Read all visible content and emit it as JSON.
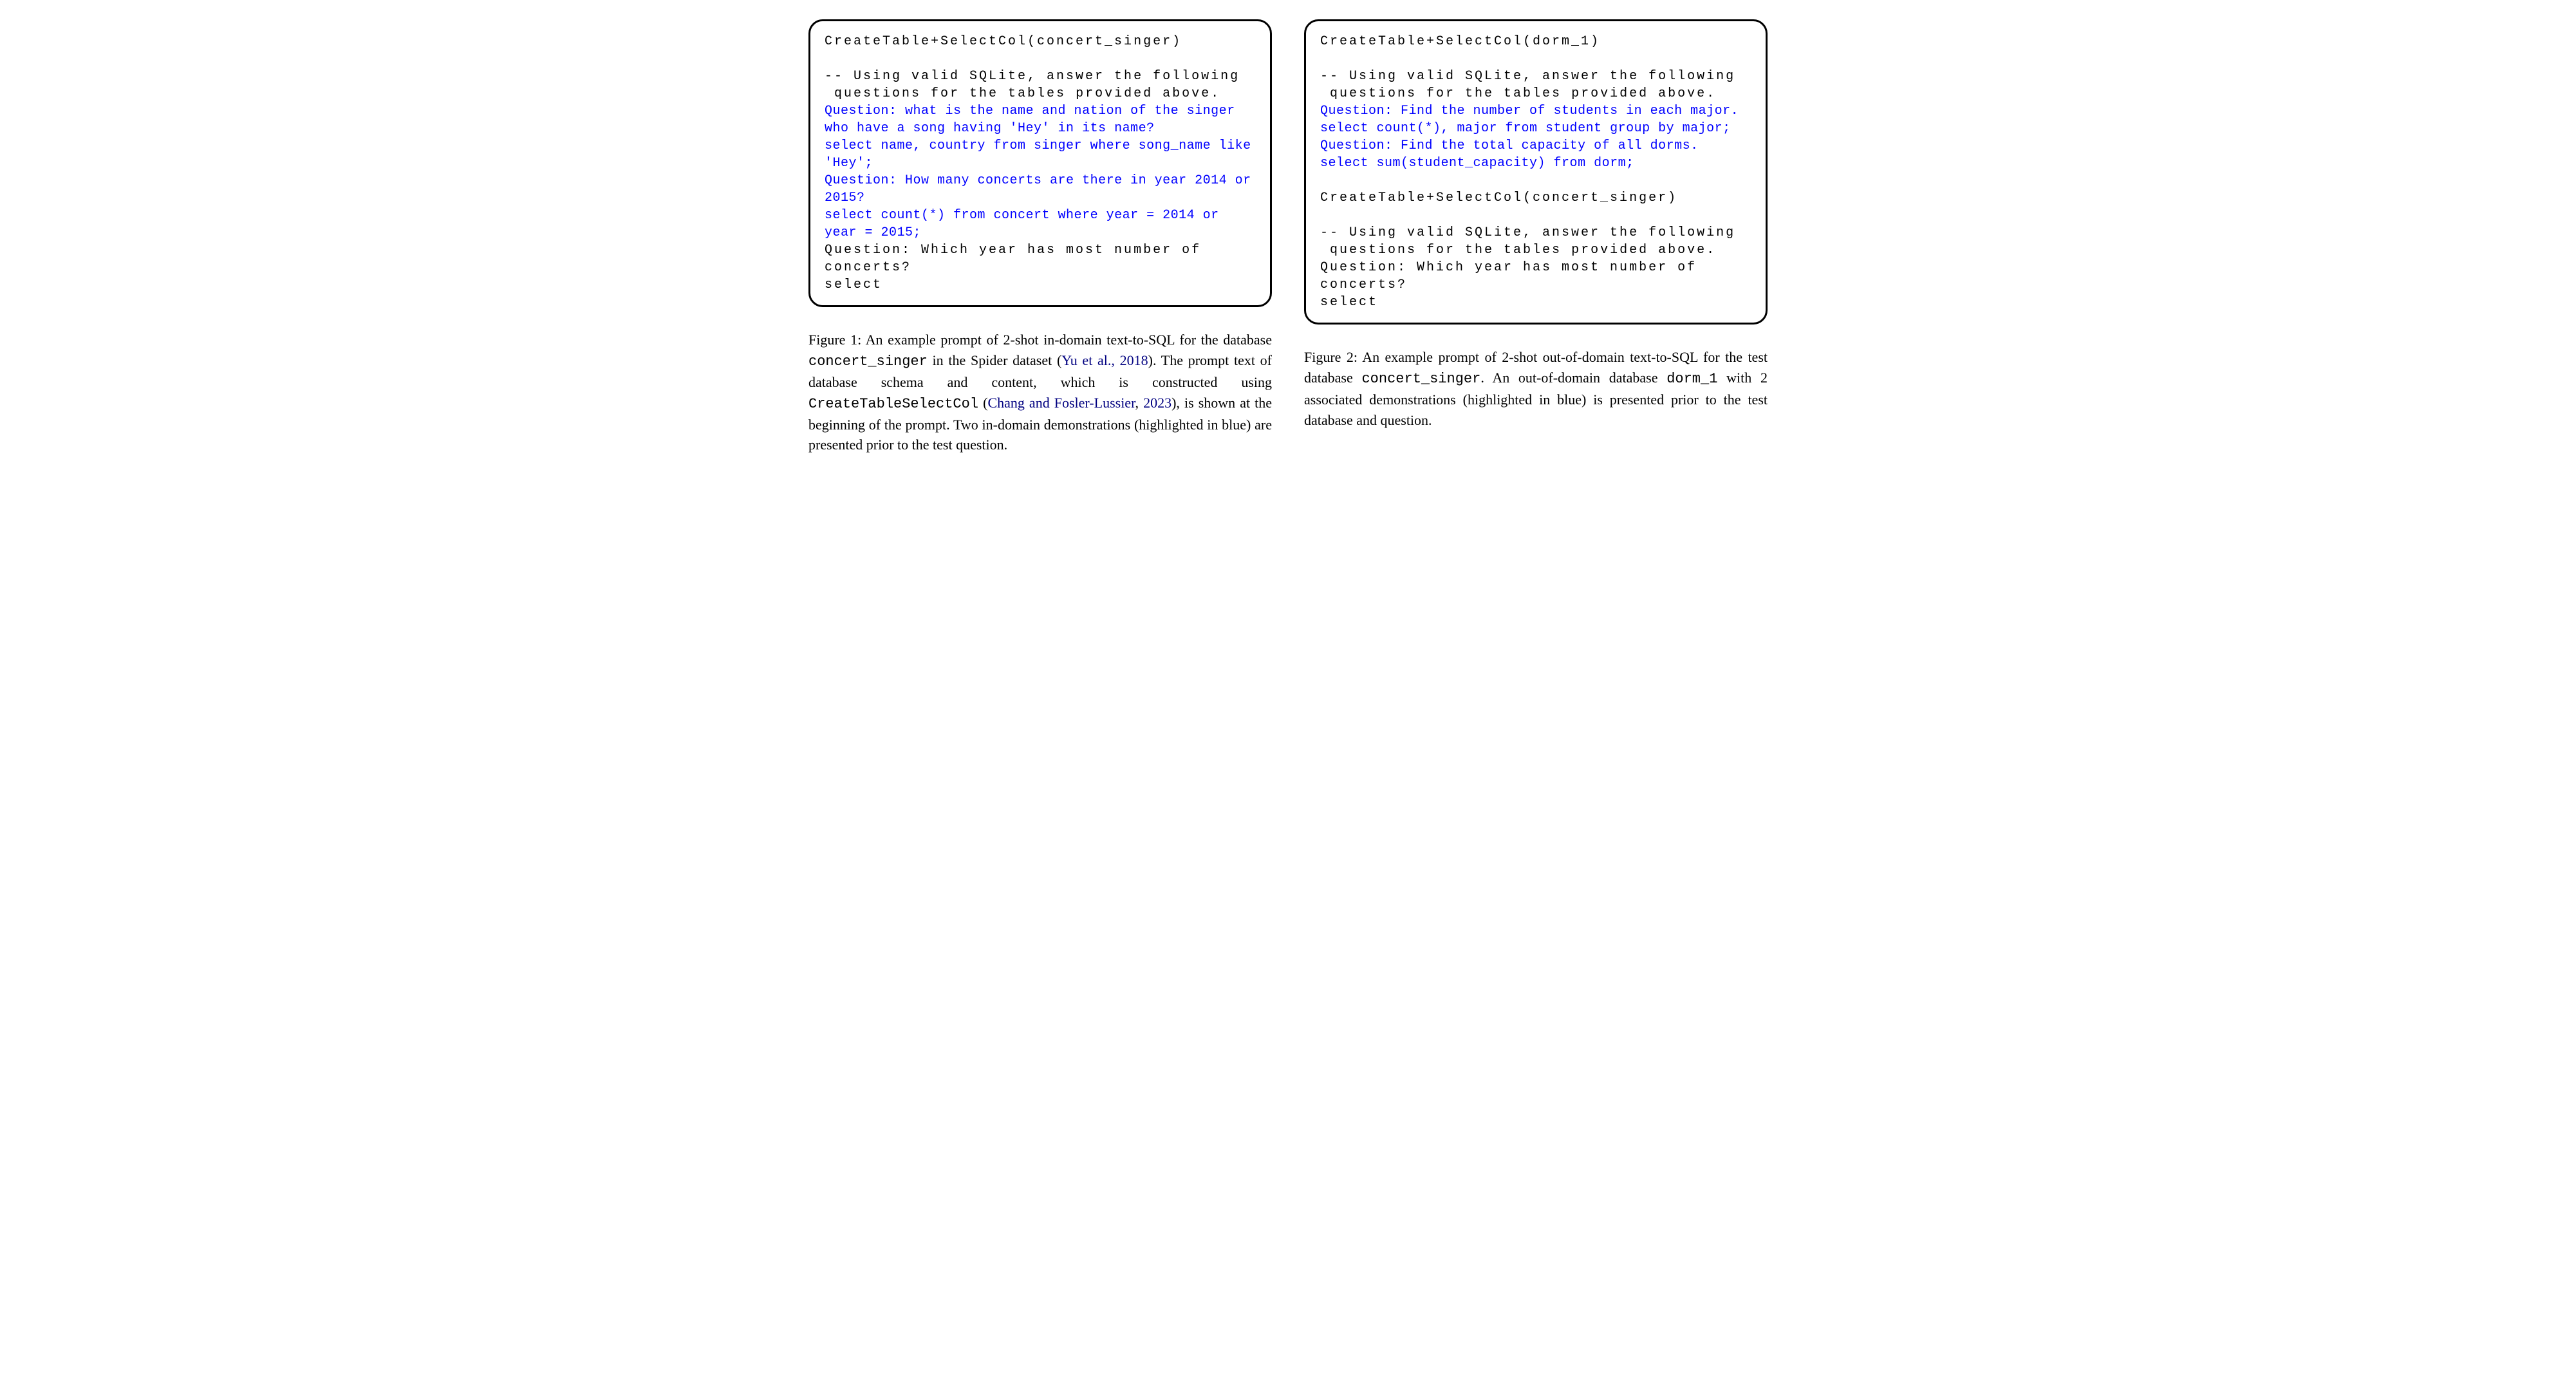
{
  "left": {
    "box": {
      "header": "CreateTable+SelectCol(concert_singer)",
      "comment": "-- Using valid SQLite, answer the following\n questions for the tables provided above.",
      "demo1": "Question: what is the name and nation of the singer who have a song having 'Hey' in its name?\nselect name, country from singer where song_name like 'Hey';\nQuestion: How many concerts are there in year 2014 or 2015?\nselect count(*) from concert where year = 2014 or year = 2015;",
      "test": "Question: Which year has most number of concerts?\nselect"
    },
    "caption": {
      "lead": "Figure 1:  An example prompt of 2-shot in-domain text-to-SQL for the database ",
      "db": "concert_singer",
      "mid1": " in the Spider dataset (",
      "cite1": "Yu et al., 2018",
      "mid2": ").  The prompt text of database schema and content, which is constructed using ",
      "method": "CreateTableSelectCol",
      "mid3": " (",
      "cite2": "Chang and Fosler-Lussier",
      "mid4": ", ",
      "cite3": "2023",
      "tail": "), is shown at the beginning of the prompt.  Two in-domain demonstrations (highlighted in blue) are presented prior to the test question."
    }
  },
  "right": {
    "box": {
      "header1": "CreateTable+SelectCol(dorm_1)",
      "comment1": "-- Using valid SQLite, answer the following\n questions for the tables provided above.",
      "demo": "Question: Find the number of students in each major.\nselect count(*), major from student group by major;\nQuestion: Find the total capacity of all dorms.\nselect sum(student_capacity) from dorm;",
      "header2": "CreateTable+SelectCol(concert_singer)",
      "comment2": "-- Using valid SQLite, answer the following\n questions for the tables provided above.",
      "test": "Question: Which year has most number of concerts?\nselect"
    },
    "caption": {
      "lead": "Figure 2: An example prompt of 2-shot out-of-domain text-to-SQL for the test database ",
      "db1": "concert_singer",
      "mid1": ". An out-of-domain database ",
      "db2": "dorm_1",
      "tail": " with 2 associated demonstrations (highlighted in blue) is presented prior to the test database and question."
    }
  }
}
